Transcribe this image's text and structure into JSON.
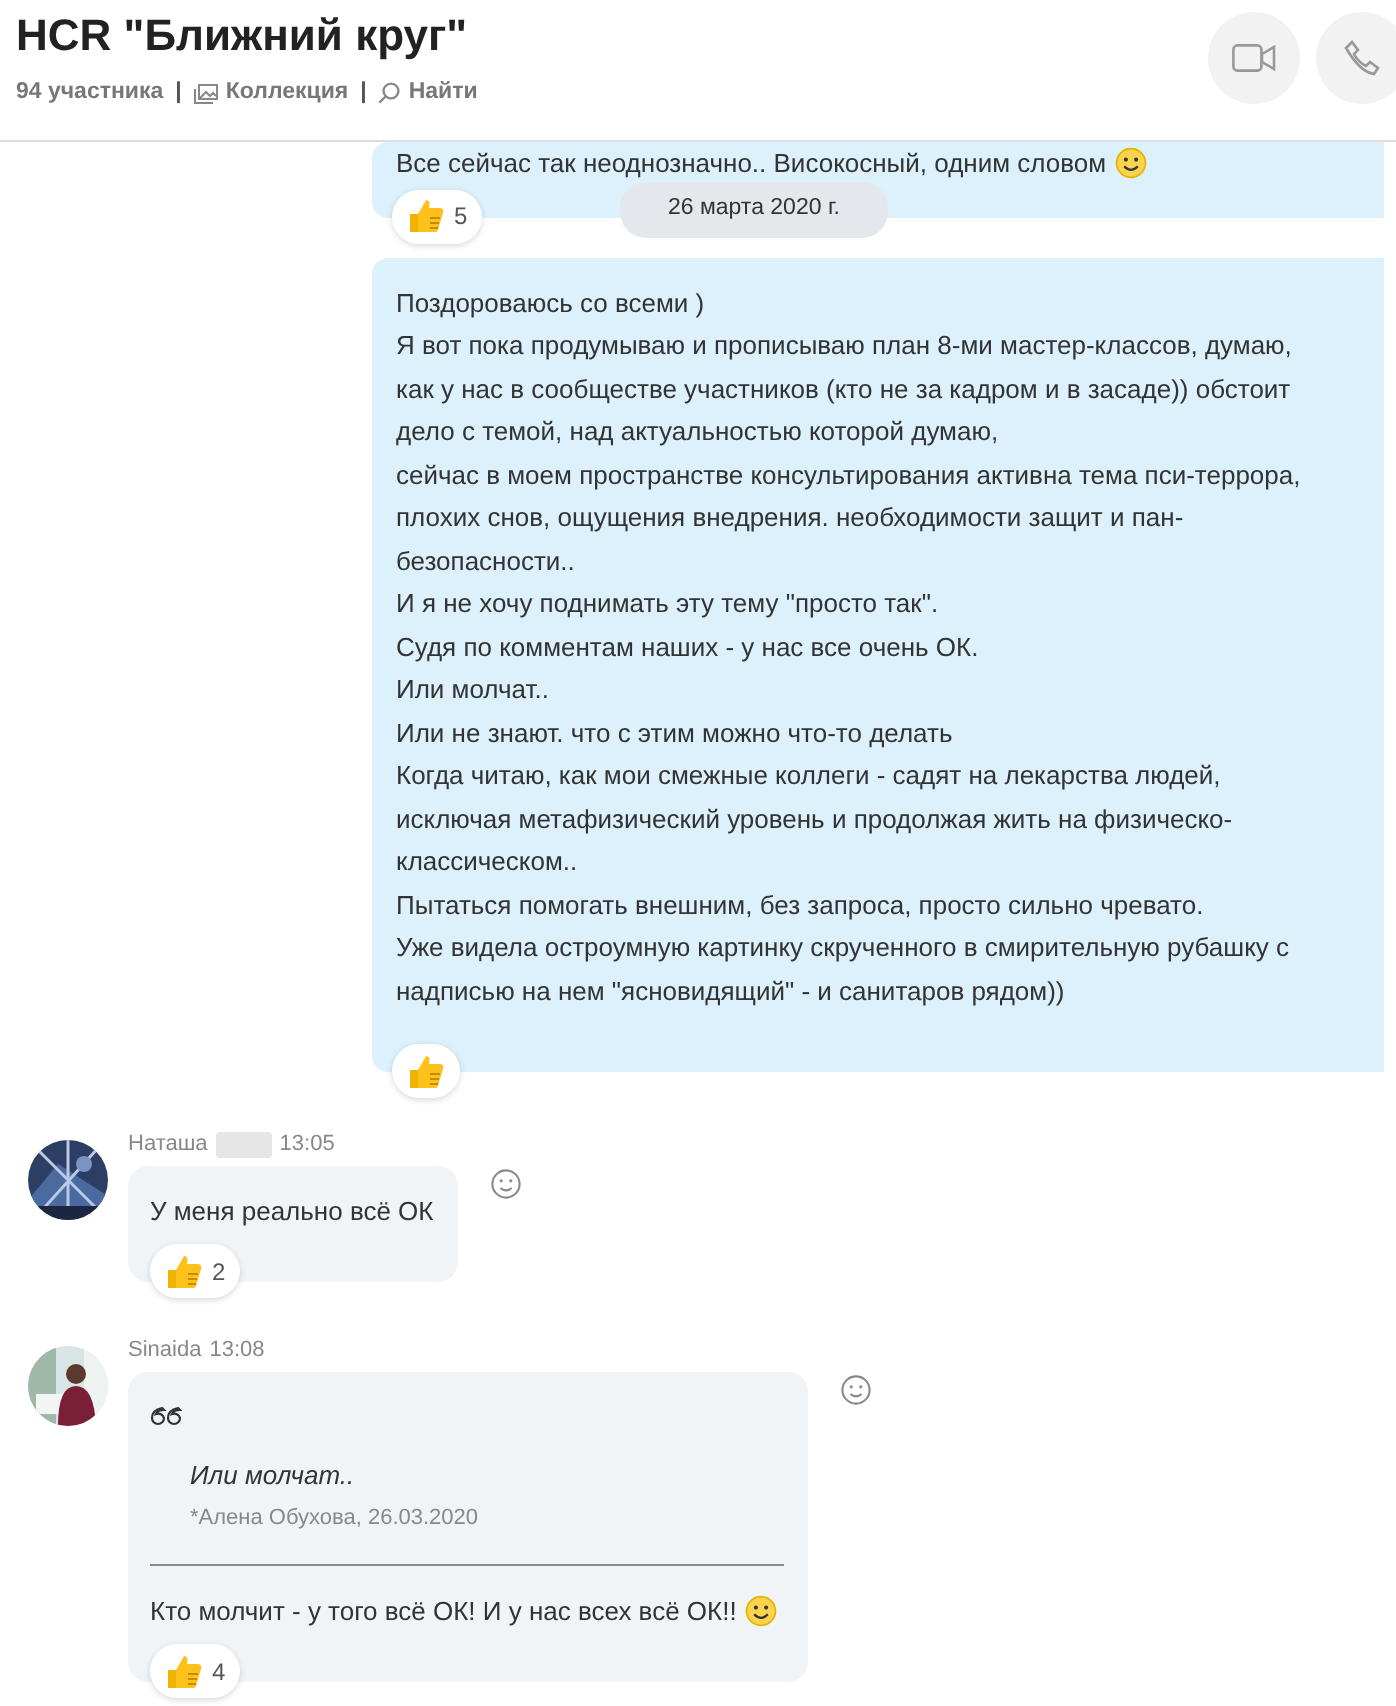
{
  "header": {
    "title": "HCR \"Ближний круг\"",
    "members": "94 участника",
    "collection": "Коллекция",
    "search": "Найти",
    "separators": [
      "|",
      "|"
    ]
  },
  "header_buttons": [
    {
      "kind": "video"
    },
    {
      "kind": "call"
    }
  ],
  "messages": [
    {
      "kind": "own",
      "lines": [
        "Все сейчас так неоднозначно.. Високосный, одним словом"
      ],
      "trailing_emoji": true,
      "reactions": [
        {
          "kind": "like",
          "count": "5"
        }
      ],
      "date": "26 марта 2020 г."
    },
    {
      "kind": "own",
      "lines": [
        "Поздороваюсь со всеми )",
        "Я вот пока продумываю и прописываю план 8-ми мастер-классов, думаю,",
        "как у нас в сообществе участников (кто не за кадром и в засаде)) обстоит",
        "дело с темой, над актуальностью которой думаю,",
        "сейчас в моем пространстве консультирования активна тема пси-террора,",
        "плохих снов, ощущения внедрения. необходимости защит и пан-",
        "безопасности..",
        "И я не хочу поднимать эту тему \"просто так\".",
        "Судя по комментам наших - у нас все очень ОК.",
        "Или молчат..",
        "Или не знают. что с этим можно что-то делать",
        "Когда читаю, как мои смежные коллеги - садят на лекарства людей,",
        "исключая метафизический уровень и продолжая жить на физическо-",
        "классическом..",
        "Пытаться помогать внешним, без запроса, просто сильно чревато.",
        "Уже видела остроумную картинку скрученного в смирительную рубашку с",
        "надписью на нем \"ясновидящий\" - и санитаров рядом))"
      ],
      "reactions": [
        {
          "kind": "like"
        }
      ]
    },
    {
      "kind": "incoming",
      "author": "Наташа",
      "redacted": true,
      "time": "13:05",
      "lines": [
        "У меня реально всё ОК"
      ],
      "reactions": [
        {
          "kind": "like",
          "count": "2"
        }
      ]
    },
    {
      "kind": "incoming",
      "author": "Sinaida",
      "time": "13:08",
      "quote": {
        "text": "Или молчат..",
        "source": "*Алена Обухова, 26.03.2020"
      },
      "lines": [
        "Кто молчит - у того всё ОК! И у нас всех всё ОК!!"
      ],
      "trailing_emoji": true,
      "reactions": [
        {
          "kind": "like",
          "count": "4"
        }
      ]
    }
  ]
}
